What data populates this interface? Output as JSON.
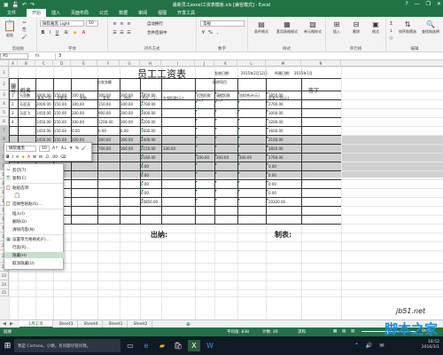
{
  "titlebar": {
    "title": "最新员工excel工资表模板.xls [兼容模式] - Excel",
    "help": "?",
    "minimize": "—",
    "restore": "❐",
    "close": "✕"
  },
  "tabs": {
    "file": "文件",
    "items": [
      "开始",
      "插入",
      "页面布局",
      "公式",
      "数据",
      "审阅",
      "视图",
      "开发工具"
    ],
    "active": 0
  },
  "ribbon": {
    "paste": "粘贴",
    "clipboard_label": "剪贴板",
    "font_name": "微软雅黑 Light",
    "font_size": "10",
    "font_label": "字体",
    "wrap": "自动换行",
    "merge": "合并后居中",
    "align_label": "对齐方式",
    "number_format": "常规",
    "number_label": "数字",
    "cond_format": "条件格式",
    "table_format": "套用表格格式",
    "cell_style": "单元格样式",
    "style_label": "样式",
    "insert": "插入",
    "delete": "删除",
    "format": "格式",
    "cells_label": "单元格",
    "sort": "排序和筛选",
    "find": "查找和选择",
    "edit_label": "编辑"
  },
  "formula_bar": {
    "name_box": "A5",
    "fx": "fx",
    "value": "3"
  },
  "columns": [
    "A",
    "B",
    "C",
    "D",
    "E",
    "F",
    "G",
    "H",
    "I",
    "J",
    "K",
    "L",
    "M",
    "N"
  ],
  "rows": [
    "1",
    "2",
    "3",
    "4",
    "5",
    "6",
    "7",
    "8",
    "9",
    "10",
    "11",
    "12",
    "13",
    "14",
    "15",
    "16",
    "17",
    "18",
    "19",
    "20",
    "21",
    "22",
    "23",
    "24",
    "25"
  ],
  "sheet": {
    "title": "员工工资表",
    "issue_date_label": "发放日期：",
    "issue_date": "2015年2月12日",
    "period_label": "所属日期：",
    "period": "2015年1月",
    "col_no": "编号",
    "col_name": "姓名",
    "payable_group": "应发金额",
    "deduct_group": "扣除项目",
    "h_basic": "基本工资",
    "h_bonus": "全勤奖",
    "h_subsidy": "补助",
    "h_other": "奖金",
    "h_overtime": "加班",
    "h_total": "合计（元）",
    "h_social": "社保扣款(元)",
    "h_late": "迟到扣款(元)",
    "h_leave": "请假扣款(元)",
    "h_deduct_total": "应扣合计(元)",
    "h_net": "实发工资(元)",
    "h_sign": "签字",
    "data_rows": [
      {
        "no": "1",
        "name": "马亚鹏",
        "c": "3000.00",
        "d": "150.00",
        "e": "100.00",
        "f": "300.00",
        "g": "300.00",
        "h": "3850.00",
        "i": "",
        "j": "",
        "k": "",
        "l": "",
        "m": "3850.00"
      },
      {
        "no": "2",
        "name": "马亚涛",
        "c": "2000.00",
        "d": "150.00",
        "e": "100.00",
        "f": "150.00",
        "g": "300.00",
        "h": "2700.00",
        "i": "",
        "j": "",
        "k": "",
        "l": "",
        "m": "2700.00"
      },
      {
        "no": "3",
        "name": "马亚飞",
        "c": "1450.00",
        "d": "150.00",
        "e": "200.00",
        "f": "900.00",
        "g": "300.00",
        "h": "3000.00",
        "i": "",
        "j": "",
        "k": "",
        "l": "",
        "m": "3000.00"
      },
      {
        "no": "4",
        "name": "",
        "c": "1450.00",
        "d": "150.00",
        "e": "100.00",
        "f": "1200.00",
        "g": "300.00",
        "h": "3200.00",
        "i": "",
        "j": "",
        "k": "",
        "l": "",
        "m": "3200.00"
      },
      {
        "no": "",
        "name": "",
        "c": "1450.00",
        "d": "150.00",
        "e": "0.00",
        "f": "0.00",
        "g": "0.00",
        "h": "1600.00",
        "i": "",
        "j": "",
        "k": "",
        "l": "",
        "m": "1600.00"
      },
      {
        "no": "",
        "name": "",
        "c": "1450.00",
        "d": "150.00",
        "e": "200.00",
        "f": "300.00",
        "g": "300.00",
        "h": "2400.00",
        "i": "",
        "j": "",
        "k": "",
        "l": "",
        "m": "2100.00"
      },
      {
        "no": "",
        "name": "",
        "c": "",
        "d": "",
        "e": "",
        "f": "700.00",
        "g": "300.00",
        "h": "2150.00",
        "i": "330.00",
        "j": "",
        "k": "",
        "l": "",
        "m": "1820.00"
      },
      {
        "no": "",
        "name": "",
        "c": "",
        "d": "",
        "e": "",
        "f": "",
        "g": "",
        "h": "2160.00",
        "i": "",
        "j": "200.00",
        "k": "200.00",
        "l": "200.00",
        "m": "2760.00"
      },
      {
        "no": "",
        "name": "",
        "c": "",
        "d": "",
        "e": "",
        "f": "",
        "g": "",
        "h": "0.00",
        "i": "",
        "j": "",
        "k": "",
        "l": "",
        "m": "0.00"
      },
      {
        "no": "",
        "name": "",
        "c": "",
        "d": "",
        "e": "",
        "f": "",
        "g": "",
        "h": "0.00",
        "i": "",
        "j": "",
        "k": "",
        "l": "",
        "m": "0.00"
      },
      {
        "no": "",
        "name": "",
        "c": "",
        "d": "",
        "e": "",
        "f": "",
        "g": "",
        "h": "0.00",
        "i": "",
        "j": "",
        "k": "",
        "l": "",
        "m": "0.00"
      },
      {
        "no": "",
        "name": "",
        "c": "",
        "d": "",
        "e": "",
        "f": "",
        "g": "",
        "h": "0.00",
        "i": "",
        "j": "",
        "k": "",
        "l": "",
        "m": "0.00"
      },
      {
        "no": "",
        "name": "",
        "c": "",
        "d": "",
        "e": "",
        "f": "",
        "g": "",
        "h": "20850.00",
        "i": "",
        "j": "",
        "k": "",
        "l": "",
        "m": "20320.00"
      }
    ],
    "cashier_label": "出纳:",
    "preparer_label": "制表:"
  },
  "mini_toolbar": {
    "font": "微软雅黑",
    "size": "10",
    "bold": "B",
    "italic": "I"
  },
  "context_menu": {
    "items": [
      "剪切(T)",
      "复制(C)",
      "粘贴选项:",
      "",
      "选择性粘贴(S)...",
      "插入(I)",
      "删除(D)",
      "清除内容(N)",
      "设置单元格格式(F)...",
      "行高(R)...",
      "隐藏(H)",
      "取消隐藏(U)"
    ],
    "selected": 10
  },
  "sheet_tabs": {
    "items": [
      "1月工资",
      "Sheet3",
      "Sheet4",
      "Sheet1",
      "Sheet2"
    ],
    "add": "⊕",
    "active": 0
  },
  "status": {
    "left": "就绪",
    "avg": "平均值: 838",
    "count": "计数: 40",
    "sum": "求和",
    "zoom": "80%"
  },
  "taskbar": {
    "search": "我是 Cortana，小娜。有问题尽管问我。",
    "time": "18:52",
    "date": "2016/3/1"
  },
  "watermark": {
    "line1": "jb51.net",
    "line2": "脚本之家"
  },
  "colors": {
    "excel_green": "#217346",
    "selected_row": "#d0d0d0",
    "menu_highlight": "#c6e0ce"
  }
}
